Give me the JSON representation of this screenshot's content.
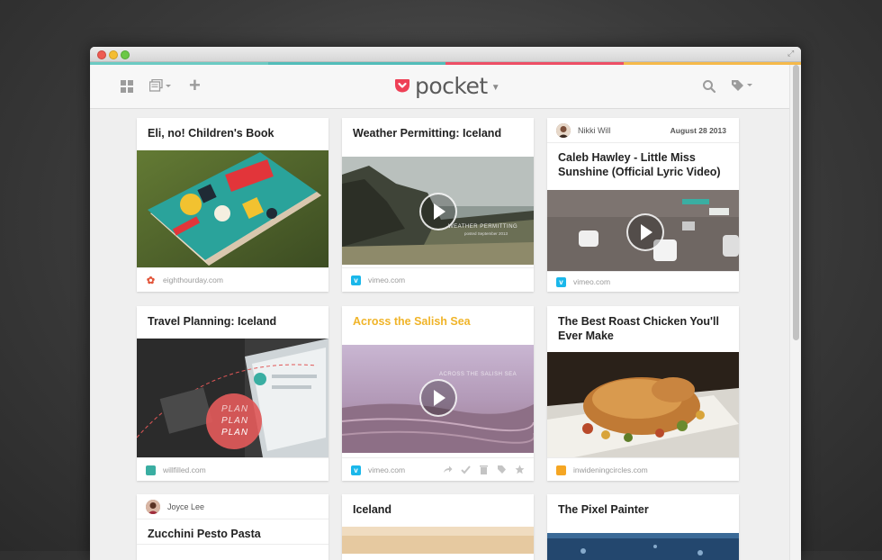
{
  "app": {
    "logo_text": "pocket",
    "accent_color": "#ee4056",
    "colorbar": [
      "#6bcbc3",
      "#52bdb9",
      "#ee4f66",
      "#f5b94a"
    ]
  },
  "toolbar": {
    "icons": [
      "grid-view-icon",
      "list-view-icon",
      "add-icon",
      "search-icon",
      "tag-icon"
    ]
  },
  "cards": [
    {
      "title": "Eli, no! Children's Book",
      "domain": "eighthourday.com",
      "video": false
    },
    {
      "title": "Weather Permitting: Iceland",
      "domain": "vimeo.com",
      "video": true,
      "thumb_caption": "WEATHER PERMITTING",
      "thumb_subcaption": "posted September 2013"
    },
    {
      "author": "Nikki Will",
      "date": "August 28 2013",
      "title": "Caleb Hawley - Little Miss Sunshine (Official Lyric Video)",
      "domain": "vimeo.com",
      "video": true
    },
    {
      "title": "Travel Planning: Iceland",
      "domain": "willfilled.com",
      "video": false,
      "thumb_text": [
        "PLAN",
        "PLAN",
        "PLAN"
      ]
    },
    {
      "title": "Across the Salish Sea",
      "domain": "vimeo.com",
      "video": true,
      "thumb_caption": "ACROSS THE SALISH SEA"
    },
    {
      "title": "The Best Roast Chicken You'll Ever Make",
      "domain": "inwideningcircles.com",
      "video": false
    },
    {
      "author": "Joyce Lee",
      "title": "Zucchini Pesto Pasta"
    },
    {
      "title": "Iceland"
    },
    {
      "title": "The Pixel Painter"
    }
  ]
}
